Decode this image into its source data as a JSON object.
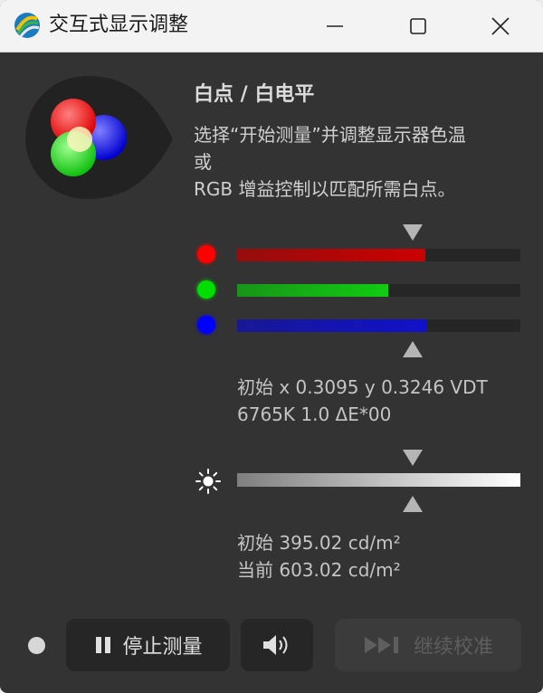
{
  "window": {
    "title": "交互式显示调整",
    "icon": "displaycal-icon"
  },
  "section": {
    "heading": "白点 / 白电平",
    "description_lines": [
      "选择“开始测量”并调整显示器色温",
      "或",
      "RGB 增益控制以匹配所需白点。"
    ]
  },
  "channels": [
    {
      "name": "red",
      "color": "#ff0000",
      "bar_color": "#cc0000",
      "level": 0.665
    },
    {
      "name": "green",
      "color": "#00dd00",
      "bar_color": "#11cc11",
      "level": 0.535
    },
    {
      "name": "blue",
      "color": "#0000ff",
      "bar_color": "#1111cc",
      "level": 0.67
    }
  ],
  "target_marker_rgb": 0.62,
  "whitepoint_readout": {
    "line1": "初始 x 0.3095 y 0.3246 VDT",
    "line2": "6765K 1.0 ΔE*00"
  },
  "luminance": {
    "icon": "sun-icon",
    "target_marker": 0.62,
    "readout_initial": "初始 395.02 cd/m²",
    "readout_current": "当前 603.02 cd/m²"
  },
  "controls": {
    "stop_label": "停止测量",
    "stop_icon": "pause-icon",
    "sound_icon": "speaker-icon",
    "continue_label": "继续校准",
    "continue_icon": "skip-forward-icon"
  }
}
